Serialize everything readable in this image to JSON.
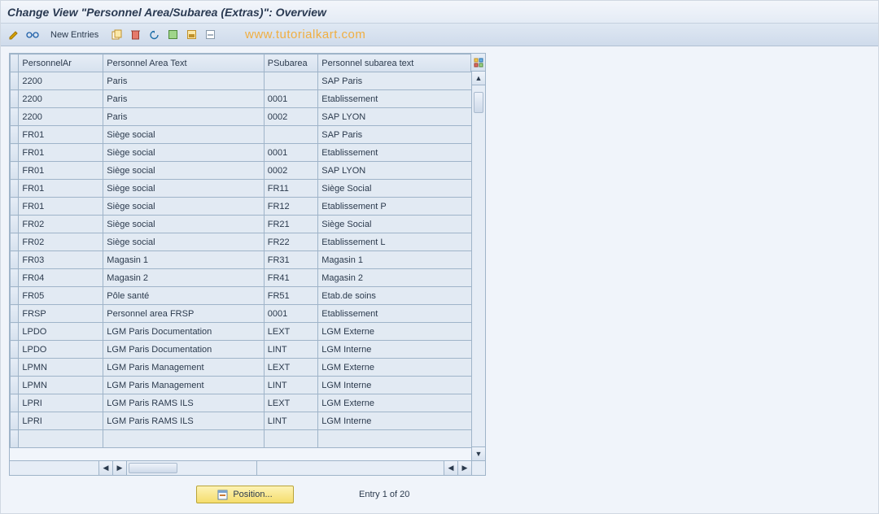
{
  "title": "Change View \"Personnel Area/Subarea (Extras)\": Overview",
  "toolbar": {
    "new_entries": "New Entries"
  },
  "watermark": "www.tutorialkart.com",
  "columns": {
    "sel": "",
    "c1": "PersonnelAr",
    "c2": "Personnel Area Text",
    "c3": "PSubarea",
    "c4": "Personnel subarea text"
  },
  "rows": [
    {
      "c1": "2200",
      "c2": "Paris",
      "c3": "",
      "c4": "SAP Paris"
    },
    {
      "c1": "2200",
      "c2": "Paris",
      "c3": "0001",
      "c4": "Etablissement"
    },
    {
      "c1": "2200",
      "c2": "Paris",
      "c3": "0002",
      "c4": "SAP LYON"
    },
    {
      "c1": "FR01",
      "c2": "Siège social",
      "c3": "",
      "c4": "SAP Paris"
    },
    {
      "c1": "FR01",
      "c2": "Siège social",
      "c3": "0001",
      "c4": "Etablissement"
    },
    {
      "c1": "FR01",
      "c2": "Siège social",
      "c3": "0002",
      "c4": "SAP LYON"
    },
    {
      "c1": "FR01",
      "c2": "Siège social",
      "c3": "FR11",
      "c4": "Siège Social"
    },
    {
      "c1": "FR01",
      "c2": "Siège social",
      "c3": "FR12",
      "c4": "Etablissement P"
    },
    {
      "c1": "FR02",
      "c2": "Siège social",
      "c3": "FR21",
      "c4": "Siège Social"
    },
    {
      "c1": "FR02",
      "c2": "Siège social",
      "c3": "FR22",
      "c4": "Etablissement L"
    },
    {
      "c1": "FR03",
      "c2": "Magasin 1",
      "c3": "FR31",
      "c4": "Magasin 1"
    },
    {
      "c1": "FR04",
      "c2": "Magasin 2",
      "c3": "FR41",
      "c4": "Magasin 2"
    },
    {
      "c1": "FR05",
      "c2": "Pôle santé",
      "c3": "FR51",
      "c4": "Etab.de soins"
    },
    {
      "c1": "FRSP",
      "c2": "Personnel area FRSP",
      "c3": "0001",
      "c4": "Etablissement"
    },
    {
      "c1": "LPDO",
      "c2": "LGM Paris Documentation",
      "c3": "LEXT",
      "c4": "LGM Externe"
    },
    {
      "c1": "LPDO",
      "c2": "LGM Paris Documentation",
      "c3": "LINT",
      "c4": "LGM Interne"
    },
    {
      "c1": "LPMN",
      "c2": "LGM Paris Management",
      "c3": "LEXT",
      "c4": "LGM Externe"
    },
    {
      "c1": "LPMN",
      "c2": "LGM Paris Management",
      "c3": "LINT",
      "c4": "LGM Interne"
    },
    {
      "c1": "LPRI",
      "c2": "LGM Paris RAMS ILS",
      "c3": "LEXT",
      "c4": "LGM Externe"
    },
    {
      "c1": "LPRI",
      "c2": "LGM Paris RAMS ILS",
      "c3": "LINT",
      "c4": "LGM Interne"
    }
  ],
  "footer": {
    "position": "Position...",
    "entry": "Entry 1 of 20"
  }
}
